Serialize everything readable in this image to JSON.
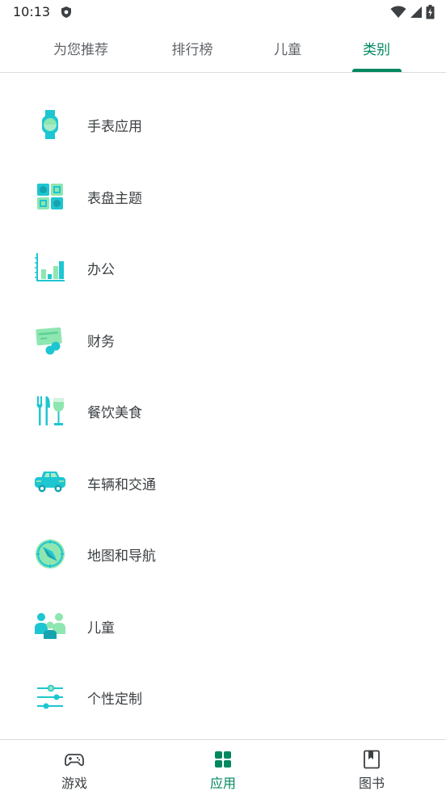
{
  "status": {
    "time": "10:13"
  },
  "tabs": [
    {
      "label": "为您推荐"
    },
    {
      "label": "排行榜"
    },
    {
      "label": "儿童"
    },
    {
      "label": "类别"
    }
  ],
  "categories": [
    {
      "label": "手表应用",
      "icon": "watch-icon"
    },
    {
      "label": "表盘主题",
      "icon": "watch-faces-icon"
    },
    {
      "label": "办公",
      "icon": "chart-icon"
    },
    {
      "label": "财务",
      "icon": "money-icon"
    },
    {
      "label": "餐饮美食",
      "icon": "food-drink-icon"
    },
    {
      "label": "车辆和交通",
      "icon": "car-icon"
    },
    {
      "label": "地图和导航",
      "icon": "compass-icon"
    },
    {
      "label": "儿童",
      "icon": "family-icon"
    },
    {
      "label": "个性定制",
      "icon": "sliders-icon"
    }
  ],
  "bottom_nav": [
    {
      "label": "游戏",
      "icon": "gamepad-icon"
    },
    {
      "label": "应用",
      "icon": "apps-grid-icon"
    },
    {
      "label": "图书",
      "icon": "book-icon"
    }
  ],
  "colors": {
    "accent": "#01875f",
    "icon_teal": "#1ec6d1",
    "icon_green": "#8ee6b0",
    "divider": "#dadce0"
  }
}
